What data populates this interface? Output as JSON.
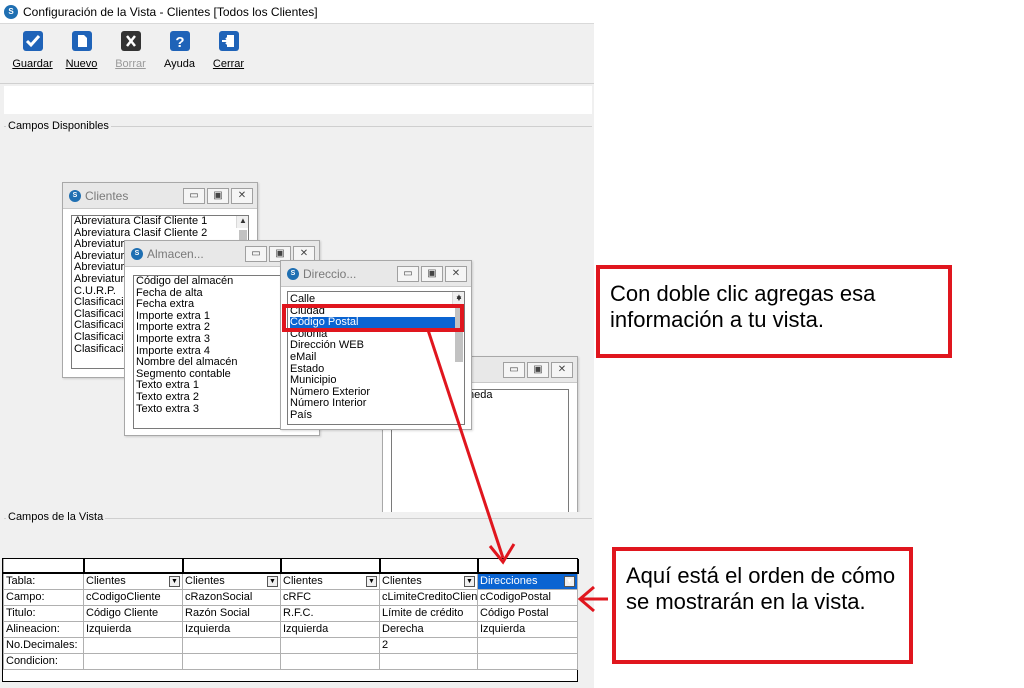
{
  "window": {
    "title": "Configuración de la Vista - Clientes [Todos los Clientes]"
  },
  "toolbar": {
    "buttons": [
      {
        "label": "Guardar",
        "icon": "check-icon",
        "color": "#1f63b8"
      },
      {
        "label": "Nuevo",
        "icon": "new-document-icon",
        "color": "#1f63b8"
      },
      {
        "label": "Borrar",
        "icon": "delete-x-icon",
        "color": "#333333"
      },
      {
        "label": "Ayuda",
        "icon": "help-icon",
        "color": "#1f63b8"
      },
      {
        "label": "Cerrar",
        "icon": "exit-door-icon",
        "color": "#1f63b8"
      }
    ]
  },
  "groups": {
    "available": "Campos Disponibles",
    "view": "Campos de la Vista"
  },
  "clientes_window": {
    "title": "Clientes",
    "items": [
      "Abreviatura Clasif Cliente 1",
      "Abreviatura Clasif Cliente 2",
      "Abreviatura",
      "Abreviatura",
      "Abreviatura",
      "Abreviatura",
      "C.U.R.P.",
      "Clasificació",
      "Clasificació",
      "Clasificació",
      "Clasificació",
      "Clasificació"
    ]
  },
  "almacen_window": {
    "title": "Almacen...",
    "items": [
      "Código del almacén",
      "Fecha de alta",
      "Fecha extra",
      "Importe extra 1",
      "Importe extra 2",
      "Importe extra 3",
      "Importe extra 4",
      "Nombre del almacén",
      "Segmento contable",
      "Texto extra 1",
      "Texto extra 2",
      "Texto extra 3"
    ]
  },
  "direccion_window": {
    "title": "Direccio...",
    "items": [
      "Calle",
      "Ciudad",
      "Código Postal",
      "Colonia",
      "Dirección WEB",
      "eMail",
      "Estado",
      "Municipio",
      "Número Exterior",
      "Número Interior",
      "País"
    ],
    "selected_index": 2
  },
  "moneda_window": {
    "title": "",
    "items": [
      "neda"
    ]
  },
  "grid": {
    "rows": [
      {
        "header": "Tabla:",
        "cells": [
          "Clientes",
          "Clientes",
          "Clientes",
          "Clientes",
          "Direcciones"
        ]
      },
      {
        "header": "Campo:",
        "cells": [
          "cCodigoCliente",
          "cRazonSocial",
          "cRFC",
          "cLimiteCreditoCliente",
          "cCodigoPostal"
        ]
      },
      {
        "header": "Titulo:",
        "cells": [
          "Código Cliente",
          "Razón Social",
          "R.F.C.",
          "Límite de crédito",
          "Código Postal"
        ]
      },
      {
        "header": "Alineacion:",
        "cells": [
          "Izquierda",
          "Izquierda",
          "Izquierda",
          "Derecha",
          "Izquierda"
        ]
      },
      {
        "header": "No.Decimales:",
        "cells": [
          "",
          "",
          "",
          "2",
          ""
        ]
      },
      {
        "header": "Condicion:",
        "cells": [
          "",
          "",
          "",
          "",
          ""
        ]
      }
    ]
  },
  "callouts": {
    "double_click": "Con doble clic agregas esa información a tu vista.",
    "order": "Aquí está el orden de cómo se mostrarán en la vista."
  },
  "colors": {
    "accent": "#e0161e",
    "selection": "#0a64d2"
  }
}
